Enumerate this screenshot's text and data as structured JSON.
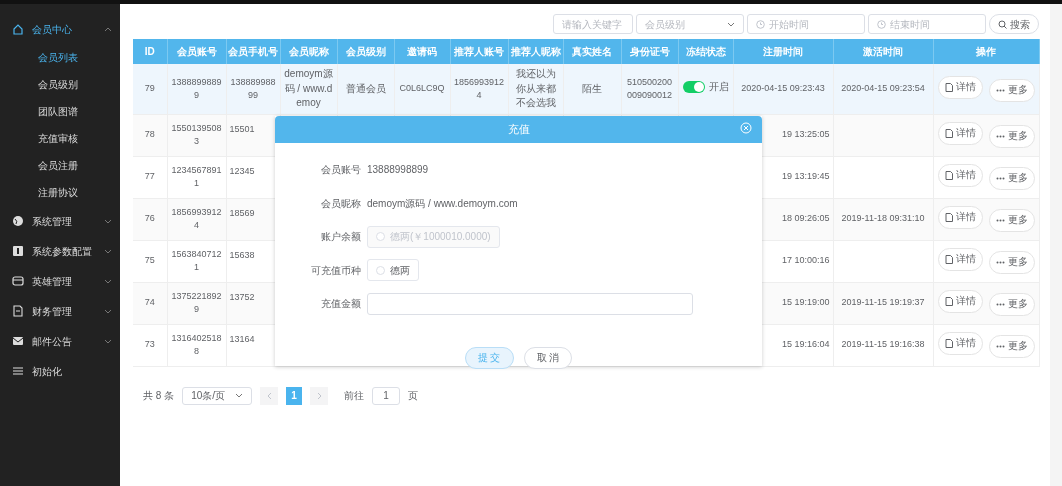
{
  "sidebar": {
    "items": [
      {
        "label": "会员中心",
        "selected": true,
        "expanded": true,
        "children": [
          {
            "label": "会员列表",
            "selected": true
          },
          {
            "label": "会员级别",
            "selected": false
          },
          {
            "label": "团队图谱",
            "selected": false
          },
          {
            "label": "充值审核",
            "selected": false
          },
          {
            "label": "会员注册",
            "selected": false
          },
          {
            "label": "注册协议",
            "selected": false
          }
        ]
      },
      {
        "label": "系统管理",
        "selected": false,
        "expanded": false
      },
      {
        "label": "系统参数配置",
        "selected": false,
        "expanded": false
      },
      {
        "label": "英雄管理",
        "selected": false,
        "expanded": false
      },
      {
        "label": "财务管理",
        "selected": false,
        "expanded": false
      },
      {
        "label": "邮件公告",
        "selected": false,
        "expanded": false
      },
      {
        "label": "初始化",
        "selected": false
      }
    ]
  },
  "search": {
    "keyword_placeholder": "请输入关键字",
    "level_placeholder": "会员级别",
    "start_placeholder": "开始时间",
    "end_placeholder": "结束时间",
    "button": "搜索"
  },
  "table": {
    "columns": [
      "ID",
      "会员账号",
      "会员手机号",
      "会员昵称",
      "会员级别",
      "邀请码",
      "推荐人账号",
      "推荐人昵称",
      "真实姓名",
      "身份证号",
      "冻结状态",
      "注册时间",
      "激活时间",
      "操作"
    ],
    "rows": [
      {
        "selected": true,
        "id": "79",
        "account": "13888998899",
        "phone": "13888998899",
        "nickname": "demoym源码 / www.demoy",
        "level": "普通会员",
        "invite_code": "C0L6LC9Q",
        "referrer_account": "18569939124",
        "referrer_nickname": "我还以为你从来都不会选我",
        "real_name": "陌生",
        "id_card": "510500200009090012",
        "frozen": {
          "on": true,
          "label": "开启"
        },
        "registered": "2020-04-15 09:23:43",
        "activated": "2020-04-15 09:23:54",
        "actions": [
          "详情",
          "更多"
        ]
      },
      {
        "selected": false,
        "id": "78",
        "account": "15501395083",
        "phone": "15501",
        "registered": "19 13:25:05",
        "actions": [
          "详情",
          "更多"
        ]
      },
      {
        "selected": false,
        "id": "77",
        "account": "12345678911",
        "phone": "12345",
        "registered": "19 13:19:45",
        "actions": [
          "详情",
          "更多"
        ]
      },
      {
        "selected": false,
        "id": "76",
        "account": "18569939124",
        "phone": "18569",
        "registered": "18 09:26:05",
        "activated": "2019-11-18 09:31:10",
        "actions": [
          "详情",
          "更多"
        ]
      },
      {
        "selected": false,
        "id": "75",
        "account": "15638407121",
        "phone": "15638",
        "registered": "17 10:00:16",
        "actions": [
          "详情",
          "更多"
        ]
      },
      {
        "selected": false,
        "id": "74",
        "account": "13752218929",
        "phone": "13752",
        "registered": "15 19:19:00",
        "activated": "2019-11-15 19:19:37",
        "actions": [
          "详情",
          "更多"
        ]
      },
      {
        "selected": false,
        "id": "73",
        "account": "13164025188",
        "phone": "13164",
        "registered": "15 19:16:04",
        "activated": "2019-11-15 19:16:38",
        "actions": [
          "详情",
          "更多"
        ]
      }
    ]
  },
  "pagination": {
    "total": "共 8 条",
    "page_size": "10条/页",
    "pages": [
      {
        "label": "1",
        "selected": true
      }
    ],
    "goto_label": "前往",
    "goto_value": "1",
    "goto_suffix": "页"
  },
  "dialog": {
    "title": "充值",
    "fields": [
      {
        "kind": "text",
        "label": "会员账号",
        "value": "13888998899"
      },
      {
        "kind": "text",
        "label": "会员昵称",
        "value": "demoym源码 / www.demoym.com"
      },
      {
        "kind": "radio",
        "label": "账户余额",
        "option": "德两(￥1000010.0000)",
        "checked": false,
        "disabled": true
      },
      {
        "kind": "radio",
        "label": "可充值币种",
        "option": "德两",
        "checked": false,
        "disabled": false
      },
      {
        "kind": "input",
        "label": "充值金额"
      }
    ],
    "buttons": [
      {
        "label": "提 交",
        "kind": "primary"
      },
      {
        "label": "取 消",
        "kind": "default"
      }
    ]
  }
}
